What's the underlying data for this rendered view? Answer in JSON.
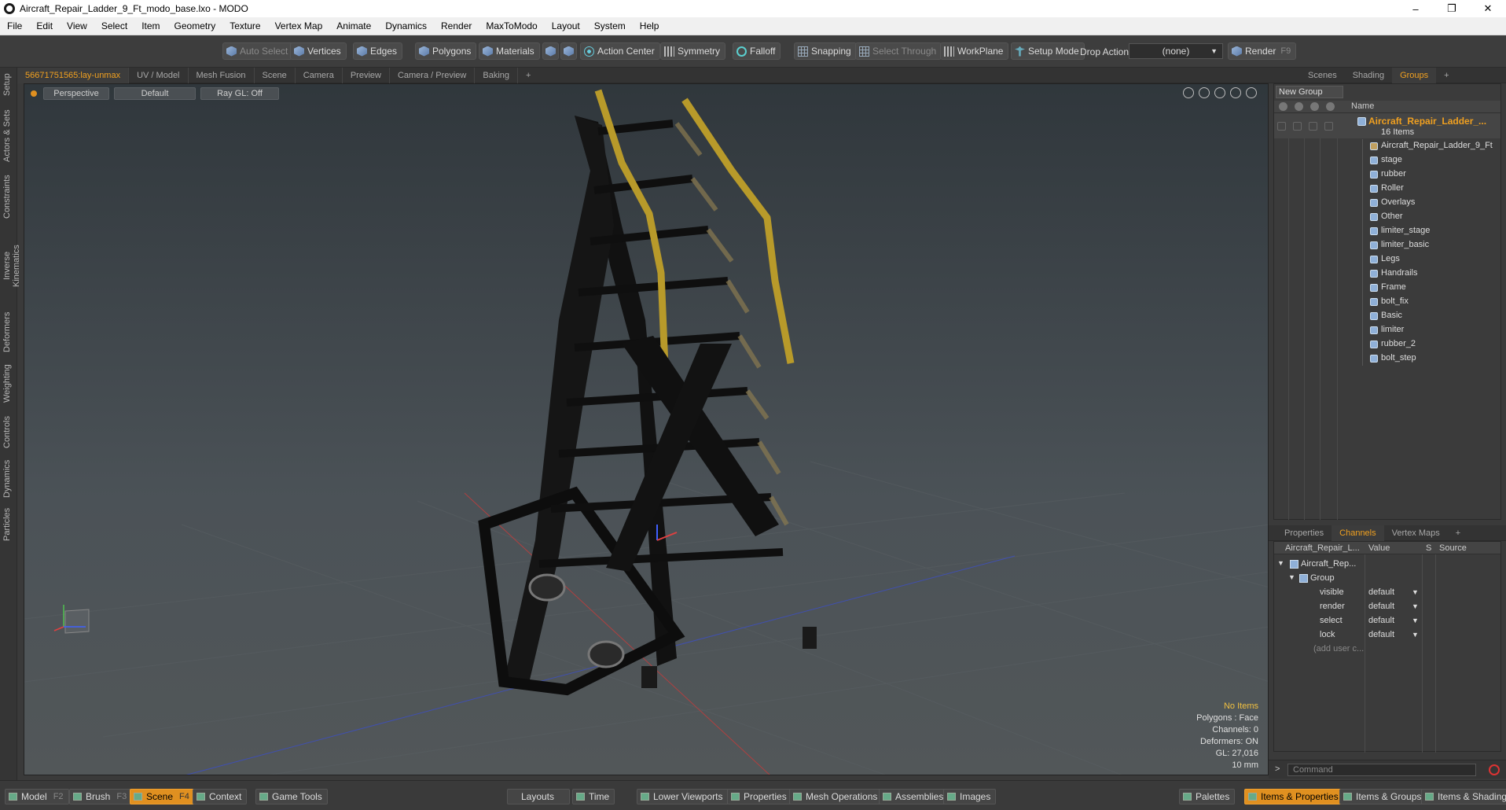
{
  "window": {
    "title": "Aircraft_Repair_Ladder_9_Ft_modo_base.lxo - MODO",
    "controls": [
      "–",
      "❐",
      "✕"
    ]
  },
  "menu": [
    "File",
    "Edit",
    "View",
    "Select",
    "Item",
    "Geometry",
    "Texture",
    "Vertex Map",
    "Animate",
    "Dynamics",
    "Render",
    "MaxToModo",
    "Layout",
    "System",
    "Help"
  ],
  "toolbar": {
    "auto_select": "Auto Select",
    "vertices": "Vertices",
    "edges": "Edges",
    "polygons": "Polygons",
    "materials": "Materials",
    "action_center": "Action Center",
    "symmetry": "Symmetry",
    "falloff": "Falloff",
    "snapping": "Snapping",
    "select_through": "Select Through",
    "workplane": "WorkPlane",
    "setup_mode": "Setup Mode",
    "drop_action": "Drop Action",
    "drop_value": "(none)",
    "render": "Render",
    "render_key": "F9"
  },
  "left_tabs": [
    "Setup",
    "Actors & Sets",
    "Constraints",
    "Inverse Kinematics",
    "Deformers",
    "Weighting",
    "Controls",
    "Dynamics",
    "Particles"
  ],
  "viewport_tabs": [
    "56671751565:lay-unmax",
    "UV / Model",
    "Mesh Fusion",
    "Scene",
    "Camera",
    "Preview",
    "Camera / Preview",
    "Baking",
    "+"
  ],
  "viewport": {
    "view": "Perspective",
    "style": "Default",
    "raygl": "Ray GL: Off",
    "info": {
      "items": "No Items",
      "polygons": "Polygons : Face",
      "channels": "Channels: 0",
      "deformers": "Deformers: ON",
      "gl": "GL: 27,016",
      "unit": "10 mm"
    }
  },
  "right_tabs": [
    "Scenes",
    "Shading",
    "Groups",
    "+"
  ],
  "groups": {
    "new_group": "New Group",
    "name_header": "Name",
    "root_name": "Aircraft_Repair_Ladder_...",
    "root_count": "16 Items",
    "items": [
      "Aircraft_Repair_Ladder_9_Ft",
      "stage",
      "rubber",
      "Roller",
      "Overlays",
      "Other",
      "limiter_stage",
      "limiter_basic",
      "Legs",
      "Handrails",
      "Frame",
      "bolt_fix",
      "Basic",
      "limiter",
      "rubber_2",
      "bolt_step"
    ]
  },
  "channel_tabs": [
    "Properties",
    "Channels",
    "Vertex Maps",
    "+"
  ],
  "channels": {
    "headers": [
      "Aircraft_Repair_L...",
      "Value",
      "S",
      "Source"
    ],
    "item": "Aircraft_Rep...",
    "group": "Group",
    "rows": [
      {
        "name": "visible",
        "value": "default"
      },
      {
        "name": "render",
        "value": "default"
      },
      {
        "name": "select",
        "value": "default"
      },
      {
        "name": "lock",
        "value": "default"
      }
    ],
    "add_user": "(add user c..."
  },
  "command": {
    "prompt": ">",
    "placeholder": "Command"
  },
  "bottom": {
    "model": "Model",
    "model_key": "F2",
    "brush": "Brush",
    "brush_key": "F3",
    "scene": "Scene",
    "scene_key": "F4",
    "context": "Context",
    "game_tools": "Game Tools",
    "layouts": "Layouts",
    "time": "Time",
    "lower_viewports": "Lower Viewports",
    "properties": "Properties",
    "mesh_operations": "Mesh Operations",
    "assemblies": "Assemblies",
    "images": "Images",
    "palettes": "Palettes",
    "items_properties": "Items & Properties",
    "items_groups": "Items & Groups",
    "items_shading": "Items & Shading"
  }
}
